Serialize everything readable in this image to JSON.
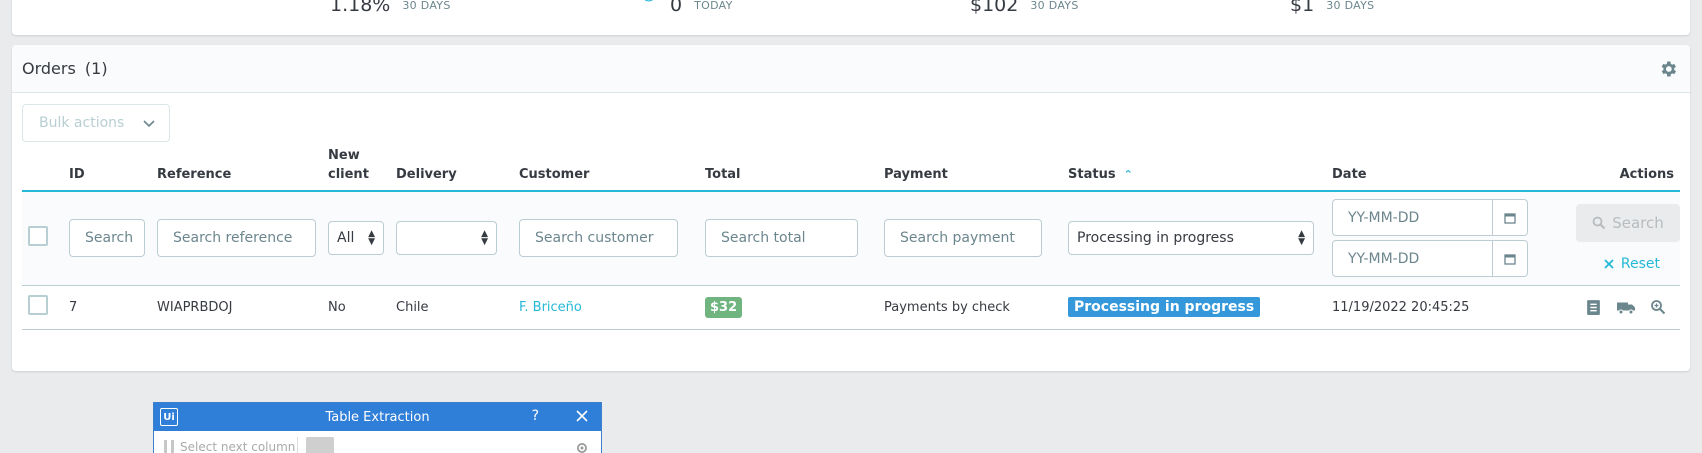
{
  "kpis": [
    {
      "value": "1.18%",
      "label": "30 DAYS",
      "icon": "conversion-icon"
    },
    {
      "value": "0",
      "label": "TODAY",
      "icon": "search-icon"
    },
    {
      "value": "$102",
      "label": "30 DAYS",
      "icon": "cart-value-icon"
    },
    {
      "value": "$1",
      "label": "30 DAYS",
      "icon": "profit-icon"
    }
  ],
  "panel": {
    "title": "Orders",
    "count": "(1)"
  },
  "bulk_actions": {
    "label": "Bulk actions"
  },
  "columns": {
    "id": "ID",
    "reference": "Reference",
    "new_client": "New client",
    "delivery": "Delivery",
    "customer": "Customer",
    "total": "Total",
    "payment": "Payment",
    "status": "Status",
    "date": "Date",
    "actions": "Actions"
  },
  "filters": {
    "id_placeholder": "Search",
    "reference_placeholder": "Search reference",
    "new_client_value": "All",
    "delivery_value": "",
    "customer_placeholder": "Search customer",
    "total_placeholder": "Search total",
    "payment_placeholder": "Search payment",
    "status_value": "Processing in progress",
    "date_from_placeholder": "YY-MM-DD",
    "date_to_placeholder": "YY-MM-DD",
    "search_label": "Search",
    "reset_label": "Reset"
  },
  "rows": [
    {
      "id": "7",
      "reference": "WIAPRBDOJ",
      "new_client": "No",
      "delivery": "Chile",
      "customer": "F. Briceño",
      "total": "$32",
      "payment": "Payments by check",
      "status": "Processing in progress",
      "date": "11/19/2022 20:45:25"
    }
  ],
  "colors": {
    "accent": "#25b9d7",
    "status_badge": "#3498db",
    "total_badge": "#70b580"
  },
  "dialog": {
    "title": "Table Extraction",
    "help": "?",
    "body_text": "Select next column"
  }
}
